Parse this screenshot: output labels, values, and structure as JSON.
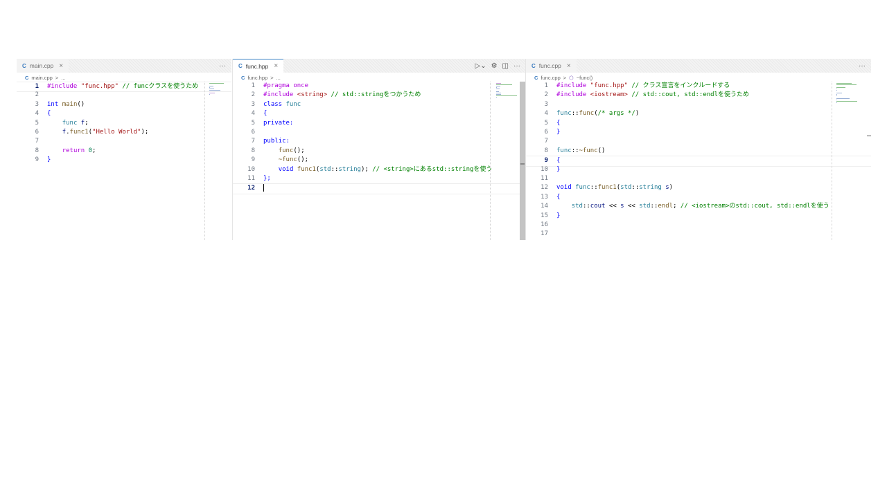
{
  "panes": [
    {
      "tab": {
        "icon": "C-file-icon",
        "label": "main.cpp",
        "close": "×",
        "active": false
      },
      "breadcrumb": {
        "file": "main.cpp",
        "sep": ">",
        "rest": "..."
      },
      "lines": [
        {
          "n": "1",
          "tokens": [
            [
              "pp",
              "#include "
            ],
            [
              "str",
              "\"func.hpp\""
            ],
            [
              "com",
              " // funcクラスを使うため"
            ]
          ],
          "current": true
        },
        {
          "n": "2",
          "tokens": []
        },
        {
          "n": "3",
          "tokens": [
            [
              "kw",
              "int"
            ],
            [
              "plain",
              " "
            ],
            [
              "fn",
              "main"
            ],
            [
              "plain",
              "()"
            ]
          ]
        },
        {
          "n": "4",
          "tokens": [
            [
              "kw",
              "{"
            ]
          ]
        },
        {
          "n": "5",
          "tokens": [
            [
              "plain",
              "    "
            ],
            [
              "type",
              "func"
            ],
            [
              "plain",
              " "
            ],
            [
              "var",
              "f"
            ],
            [
              "plain",
              ";"
            ]
          ]
        },
        {
          "n": "6",
          "tokens": [
            [
              "plain",
              "    "
            ],
            [
              "var",
              "f"
            ],
            [
              "plain",
              "."
            ],
            [
              "fn",
              "func1"
            ],
            [
              "plain",
              "("
            ],
            [
              "str",
              "\"Hello World\""
            ],
            [
              "plain",
              ");"
            ]
          ]
        },
        {
          "n": "7",
          "tokens": []
        },
        {
          "n": "8",
          "tokens": [
            [
              "plain",
              "    "
            ],
            [
              "pp",
              "return"
            ],
            [
              "plain",
              " "
            ],
            [
              "num",
              "0"
            ],
            [
              "plain",
              ";"
            ]
          ]
        },
        {
          "n": "9",
          "tokens": [
            [
              "kw",
              "}"
            ]
          ]
        }
      ]
    },
    {
      "tab": {
        "icon": "C-file-icon",
        "label": "func.hpp",
        "close": "×",
        "active": true
      },
      "actions": [
        "▷⌄",
        "⚙",
        "◫",
        "···"
      ],
      "breadcrumb": {
        "file": "func.hpp",
        "sep": ">",
        "rest": "..."
      },
      "lines": [
        {
          "n": "1",
          "tokens": [
            [
              "pp",
              "#pragma once"
            ]
          ]
        },
        {
          "n": "2",
          "tokens": [
            [
              "pp",
              "#include "
            ],
            [
              "str",
              "<string>"
            ],
            [
              "com",
              " // std::stringをつかうため"
            ]
          ]
        },
        {
          "n": "3",
          "tokens": [
            [
              "kw",
              "class"
            ],
            [
              "plain",
              " "
            ],
            [
              "type",
              "func"
            ]
          ]
        },
        {
          "n": "4",
          "tokens": [
            [
              "kw",
              "{"
            ]
          ]
        },
        {
          "n": "5",
          "tokens": [
            [
              "kw",
              "private:"
            ]
          ]
        },
        {
          "n": "6",
          "tokens": []
        },
        {
          "n": "7",
          "tokens": [
            [
              "kw",
              "public:"
            ]
          ]
        },
        {
          "n": "8",
          "tokens": [
            [
              "plain",
              "    "
            ],
            [
              "fn",
              "func"
            ],
            [
              "plain",
              "();"
            ]
          ]
        },
        {
          "n": "9",
          "tokens": [
            [
              "plain",
              "    "
            ],
            [
              "fn",
              "~func"
            ],
            [
              "plain",
              "();"
            ]
          ]
        },
        {
          "n": "10",
          "tokens": [
            [
              "plain",
              "    "
            ],
            [
              "kw",
              "void"
            ],
            [
              "plain",
              " "
            ],
            [
              "fn",
              "func1"
            ],
            [
              "plain",
              "("
            ],
            [
              "type",
              "std"
            ],
            [
              "plain",
              "::"
            ],
            [
              "type",
              "string"
            ],
            [
              "plain",
              ");"
            ],
            [
              "com",
              " // <string>にあるstd::stringを使う"
            ]
          ]
        },
        {
          "n": "11",
          "tokens": [
            [
              "kw",
              "};"
            ]
          ]
        },
        {
          "n": "12",
          "tokens": [],
          "current": true,
          "cursor": true
        }
      ]
    },
    {
      "tab": {
        "icon": "C-file-icon",
        "label": "func.cpp",
        "close": "×",
        "active": false
      },
      "breadcrumb": {
        "file": "func.cpp",
        "sep": ">",
        "symbol_icon": "⬡",
        "rest": "~func()"
      },
      "lines": [
        {
          "n": "1",
          "tokens": [
            [
              "pp",
              "#include "
            ],
            [
              "str",
              "\"func.hpp\""
            ],
            [
              "com",
              " // クラス宣言をインクルードする"
            ]
          ]
        },
        {
          "n": "2",
          "tokens": [
            [
              "pp",
              "#include "
            ],
            [
              "str",
              "<iostream>"
            ],
            [
              "com",
              " // std::cout, std::endlを使うため"
            ]
          ]
        },
        {
          "n": "3",
          "tokens": []
        },
        {
          "n": "4",
          "tokens": [
            [
              "type",
              "func"
            ],
            [
              "plain",
              "::"
            ],
            [
              "fn",
              "func"
            ],
            [
              "plain",
              "("
            ],
            [
              "com",
              "/* args */"
            ],
            [
              "plain",
              ")"
            ]
          ]
        },
        {
          "n": "5",
          "tokens": [
            [
              "kw",
              "{"
            ]
          ]
        },
        {
          "n": "6",
          "tokens": [
            [
              "kw",
              "}"
            ]
          ]
        },
        {
          "n": "7",
          "tokens": []
        },
        {
          "n": "8",
          "tokens": [
            [
              "type",
              "func"
            ],
            [
              "plain",
              "::"
            ],
            [
              "fn",
              "~func"
            ],
            [
              "plain",
              "()"
            ]
          ]
        },
        {
          "n": "9",
          "tokens": [
            [
              "kw",
              "{"
            ]
          ],
          "current": true
        },
        {
          "n": "10",
          "tokens": [
            [
              "kw",
              "}"
            ]
          ]
        },
        {
          "n": "11",
          "tokens": []
        },
        {
          "n": "12",
          "tokens": [
            [
              "kw",
              "void"
            ],
            [
              "plain",
              " "
            ],
            [
              "type",
              "func"
            ],
            [
              "plain",
              "::"
            ],
            [
              "fn",
              "func1"
            ],
            [
              "plain",
              "("
            ],
            [
              "type",
              "std"
            ],
            [
              "plain",
              "::"
            ],
            [
              "type",
              "string"
            ],
            [
              "plain",
              " "
            ],
            [
              "var",
              "s"
            ],
            [
              "plain",
              ")"
            ]
          ]
        },
        {
          "n": "13",
          "tokens": [
            [
              "kw",
              "{"
            ]
          ]
        },
        {
          "n": "14",
          "tokens": [
            [
              "plain",
              "    "
            ],
            [
              "type",
              "std"
            ],
            [
              "plain",
              "::"
            ],
            [
              "var",
              "cout"
            ],
            [
              "plain",
              " << "
            ],
            [
              "var",
              "s"
            ],
            [
              "plain",
              " << "
            ],
            [
              "type",
              "std"
            ],
            [
              "plain",
              "::"
            ],
            [
              "fn",
              "endl"
            ],
            [
              "plain",
              ";"
            ],
            [
              "com",
              " // <iostream>のstd::cout, std::endlを使う"
            ]
          ]
        },
        {
          "n": "15",
          "tokens": [
            [
              "kw",
              "}"
            ]
          ]
        },
        {
          "n": "16",
          "tokens": []
        },
        {
          "n": "17",
          "tokens": []
        }
      ]
    }
  ],
  "colors": {
    "preprocessor": "#af00db",
    "string": "#a31515",
    "comment": "#008000",
    "keyword": "#0000ff",
    "type": "#267f99",
    "function": "#795e26",
    "variable": "#001080",
    "number": "#098658",
    "active_tab_border": "#3b82c4"
  }
}
